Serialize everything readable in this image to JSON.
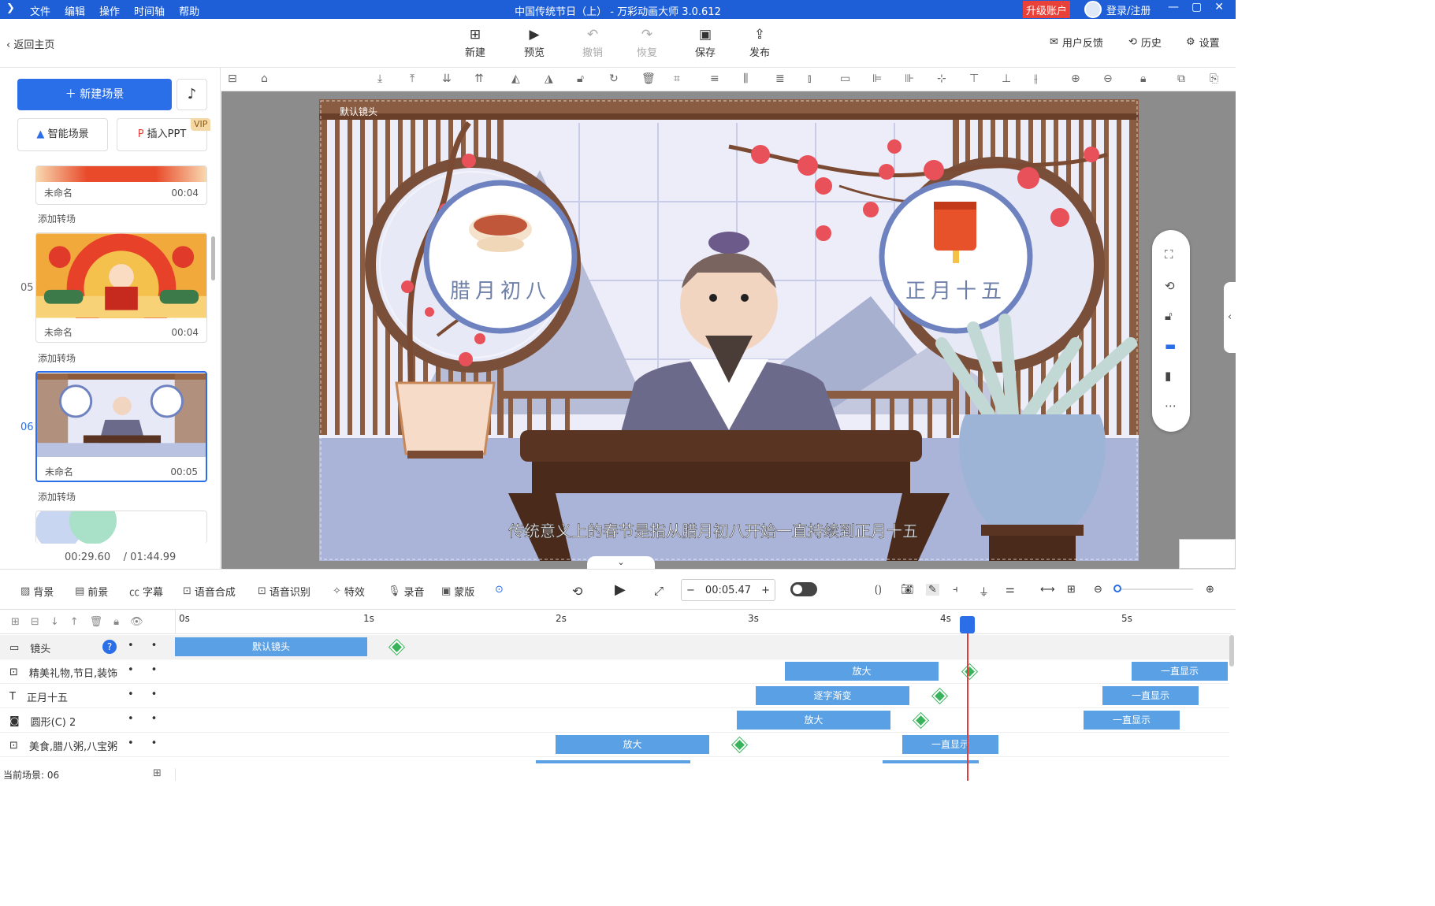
{
  "titlebar": {
    "menu": [
      "文件",
      "编辑",
      "操作",
      "时间轴",
      "帮助"
    ],
    "title": "中国传统节日（上） - 万彩动画大师 3.0.612",
    "upgrade": "升级账户",
    "login": "登录/注册"
  },
  "toolbar": {
    "back": "返回主页",
    "buttons": [
      "新建",
      "预览",
      "撤销",
      "恢复",
      "保存",
      "发布"
    ],
    "right": [
      "用户反馈",
      "历史",
      "设置"
    ]
  },
  "left": {
    "new_scene": "新建场景",
    "smart_scene": "智能场景",
    "insert_ppt": "插入PPT",
    "vip": "VIP",
    "add_transition": "添加转场",
    "scenes": [
      {
        "num": "",
        "name": "未命名",
        "duration": "00:04"
      },
      {
        "num": "05",
        "name": "未命名",
        "duration": "00:04"
      },
      {
        "num": "06",
        "name": "未命名",
        "duration": "00:05"
      }
    ],
    "current_time": "00:29.60",
    "total_time": "/ 01:44.99"
  },
  "canvas": {
    "camera_label": "默认镜头",
    "left_circle_text": "腊月初八",
    "right_circle_text": "正月十五",
    "subtitle": "传统意义上的春节是指从腊月初八开始一直持续到正月十五"
  },
  "bottombar": {
    "tools": [
      "背景",
      "前景",
      "字幕",
      "语音合成",
      "语音识别",
      "特效",
      "录音",
      "蒙版"
    ],
    "time": "00:05.47",
    "minus": "−",
    "plus": "+"
  },
  "timeline": {
    "ticks": [
      "0s",
      "1s",
      "2s",
      "3s",
      "4s",
      "5s"
    ],
    "tracks": [
      {
        "label": "镜头",
        "bars": [
          {
            "text": "默认镜头"
          }
        ]
      },
      {
        "label": "精美礼物,节日,装饰",
        "bars": [
          {
            "text": "放大"
          },
          {
            "text": "一直显示"
          }
        ]
      },
      {
        "label": "正月十五",
        "bars": [
          {
            "text": "逐字渐变"
          },
          {
            "text": "一直显示"
          }
        ]
      },
      {
        "label": "圆形(C) 2",
        "bars": [
          {
            "text": "放大"
          },
          {
            "text": "一直显示"
          }
        ]
      },
      {
        "label": "美食,腊八粥,八宝粥",
        "bars": [
          {
            "text": "放大"
          },
          {
            "text": "一直显示"
          }
        ]
      }
    ],
    "status": "当前场景: 06"
  }
}
